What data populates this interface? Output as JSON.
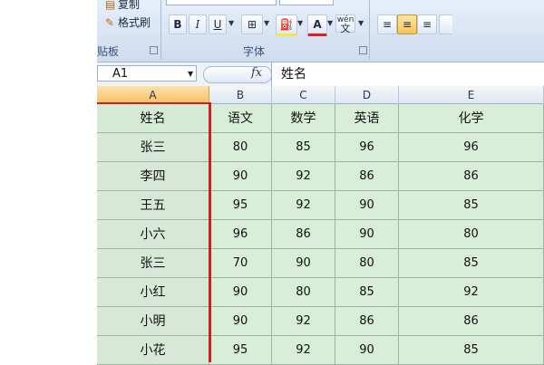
{
  "ribbon": {
    "clipboard": {
      "copy_label": "复制",
      "format_painter_label": "格式刷",
      "group_label": "贴板"
    },
    "font_group": {
      "bold": "B",
      "italic": "I",
      "underline": "U",
      "font_color": "A",
      "phonetic": "wén",
      "phonetic_char": "文",
      "group_label": "字体"
    },
    "colors": {
      "accent": "#f6c064",
      "ribbon": "#dfe8f4",
      "sheet_fill": "#d8eed8",
      "highlight_border": "#d01f1f"
    }
  },
  "formula_bar": {
    "name_box": "A1",
    "fx": "fx",
    "content": "姓名"
  },
  "sheet": {
    "columns": [
      "A",
      "B",
      "C",
      "D",
      "E"
    ],
    "selected_column": "A",
    "rows": [
      [
        "姓名",
        "语文",
        "数学",
        "英语",
        "化学"
      ],
      [
        "张三",
        "80",
        "85",
        "96",
        "96"
      ],
      [
        "李四",
        "90",
        "92",
        "86",
        "86"
      ],
      [
        "王五",
        "95",
        "92",
        "90",
        "85"
      ],
      [
        "小六",
        "96",
        "86",
        "90",
        "80"
      ],
      [
        "张三",
        "70",
        "90",
        "80",
        "85"
      ],
      [
        "小红",
        "90",
        "80",
        "85",
        "92"
      ],
      [
        "小明",
        "90",
        "92",
        "86",
        "86"
      ],
      [
        "小花",
        "95",
        "92",
        "90",
        "85"
      ]
    ]
  }
}
